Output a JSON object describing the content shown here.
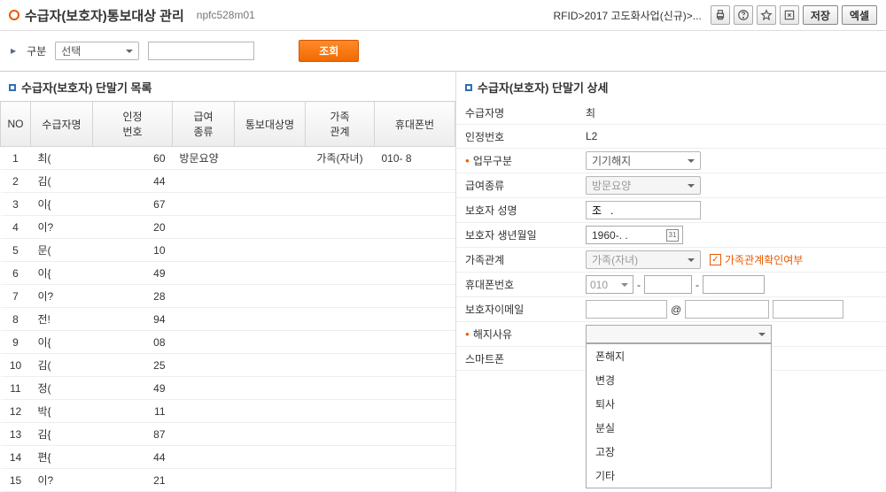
{
  "header": {
    "title": "수급자(보호자)통보대상 관리",
    "code": "npfc528m01",
    "breadcrumb": "RFID>2017 고도화사업(신규)>...",
    "save_btn": "저장",
    "excel_btn": "엑셀"
  },
  "filter": {
    "label": "구분",
    "select_value": "선택",
    "search_btn": "조회"
  },
  "left": {
    "title": "수급자(보호자) 단말기 목록",
    "columns": [
      "NO",
      "수급자명",
      "인정\n번호",
      "급여\n종류",
      "통보대상명",
      "가족\n관계",
      "휴대폰번"
    ],
    "rows": [
      {
        "no": "1",
        "name": "최(",
        "num": "60",
        "type": "방문요양",
        "target": "",
        "rel": "가족(자녀)",
        "phone": "010-          8"
      },
      {
        "no": "2",
        "name": "김(",
        "num": "44",
        "type": "",
        "target": "",
        "rel": "",
        "phone": ""
      },
      {
        "no": "3",
        "name": "이{",
        "num": "67",
        "type": "",
        "target": "",
        "rel": "",
        "phone": ""
      },
      {
        "no": "4",
        "name": "이?",
        "num": "20",
        "type": "",
        "target": "",
        "rel": "",
        "phone": ""
      },
      {
        "no": "5",
        "name": "문(",
        "num": "10",
        "type": "",
        "target": "",
        "rel": "",
        "phone": ""
      },
      {
        "no": "6",
        "name": "이{",
        "num": "49",
        "type": "",
        "target": "",
        "rel": "",
        "phone": ""
      },
      {
        "no": "7",
        "name": "이?",
        "num": "28",
        "type": "",
        "target": "",
        "rel": "",
        "phone": ""
      },
      {
        "no": "8",
        "name": "전!",
        "num": "94",
        "type": "",
        "target": "",
        "rel": "",
        "phone": ""
      },
      {
        "no": "9",
        "name": "이{",
        "num": "08",
        "type": "",
        "target": "",
        "rel": "",
        "phone": ""
      },
      {
        "no": "10",
        "name": "김(",
        "num": "25",
        "type": "",
        "target": "",
        "rel": "",
        "phone": ""
      },
      {
        "no": "11",
        "name": "정(",
        "num": "49",
        "type": "",
        "target": "",
        "rel": "",
        "phone": ""
      },
      {
        "no": "12",
        "name": "박{",
        "num": "11",
        "type": "",
        "target": "",
        "rel": "",
        "phone": ""
      },
      {
        "no": "13",
        "name": "김{",
        "num": "87",
        "type": "",
        "target": "",
        "rel": "",
        "phone": ""
      },
      {
        "no": "14",
        "name": "편{",
        "num": "44",
        "type": "",
        "target": "",
        "rel": "",
        "phone": ""
      },
      {
        "no": "15",
        "name": "이?",
        "num": "21",
        "type": "",
        "target": "",
        "rel": "",
        "phone": ""
      }
    ]
  },
  "right": {
    "title": "수급자(보호자) 단말기 상세",
    "fields": {
      "recipient_name": {
        "label": "수급자명",
        "value": "최"
      },
      "auth_no": {
        "label": "인정번호",
        "value": "L2"
      },
      "job_type": {
        "label": "업무구분",
        "value": "기기해지",
        "required": true
      },
      "benefit_type": {
        "label": "급여종류",
        "value": "방문요양"
      },
      "guardian_name": {
        "label": "보호자 성명",
        "value": "조   ."
      },
      "guardian_birth": {
        "label": "보호자 생년월일",
        "value": "1960-.    ."
      },
      "family_rel": {
        "label": "가족관계",
        "value": "가족(자녀)",
        "check_label": "가족관계확인여부"
      },
      "phone": {
        "label": "휴대폰번호",
        "prefix": "010"
      },
      "email": {
        "label": "보호자이메일",
        "at": "@"
      },
      "cancel_reason": {
        "label": "해지사유",
        "required": true,
        "options": [
          "폰해지",
          "변경",
          "퇴사",
          "분실",
          "고장",
          "기타"
        ]
      },
      "smartphone": {
        "label": "스마트폰"
      }
    }
  }
}
